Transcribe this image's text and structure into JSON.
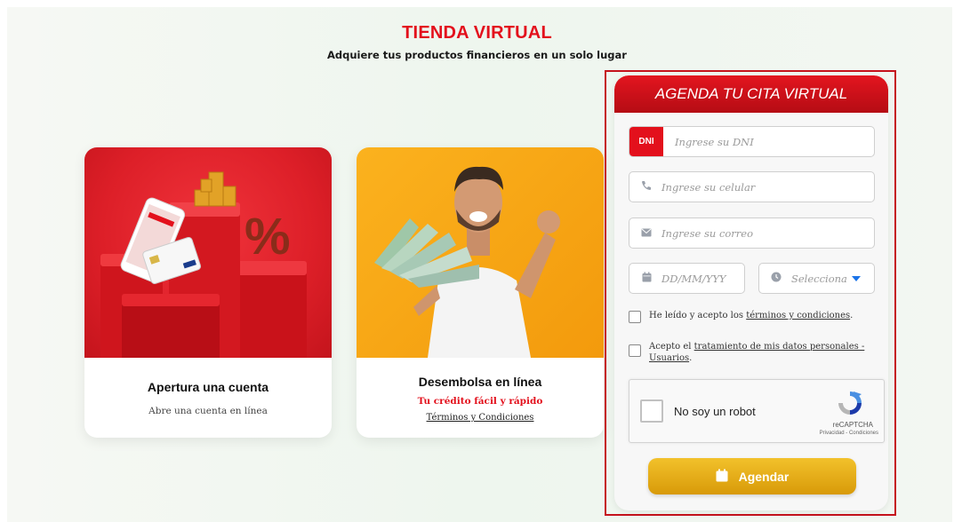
{
  "header": {
    "title": "TIENDA VIRTUAL",
    "subtitle": "Adquiere tus productos financieros en un solo lugar"
  },
  "cards": [
    {
      "title": "Apertura una cuenta",
      "description": "Abre una cuenta en línea",
      "image": "savings-account-illustration",
      "image_text": "%"
    },
    {
      "title": "Desembolsa en línea",
      "highlight": "Tu crédito fácil y rápido",
      "link": "Términos y Condiciones",
      "image": "man-holding-money-photo"
    }
  ],
  "form": {
    "title": "AGENDA TU CITA VIRTUAL",
    "dni": {
      "badge": "DNI",
      "placeholder": "Ingrese su DNI"
    },
    "phone": {
      "placeholder": "Ingrese su celular",
      "icon": "phone-icon"
    },
    "email": {
      "placeholder": "Ingrese su correo",
      "icon": "envelope-icon"
    },
    "date": {
      "placeholder": "DD/MM/YYY",
      "icon": "calendar-icon"
    },
    "time": {
      "placeholder": "Selecciona",
      "icon": "clock-icon"
    },
    "terms_check": {
      "prefix": "He leído y acepto los ",
      "link": "términos y condiciones",
      "suffix": "."
    },
    "data_check": {
      "prefix": "Acepto el ",
      "link": "tratamiento de mis datos personales - Usuarios",
      "suffix": "."
    },
    "captcha": {
      "label": "No soy un robot",
      "brand": "reCAPTCHA",
      "terms": "Privacidad - Condiciones"
    },
    "submit_label": "Agendar"
  },
  "colors": {
    "brand_red": "#e3101c",
    "gold": "#e0a812",
    "card_orange": "#f6a214"
  }
}
